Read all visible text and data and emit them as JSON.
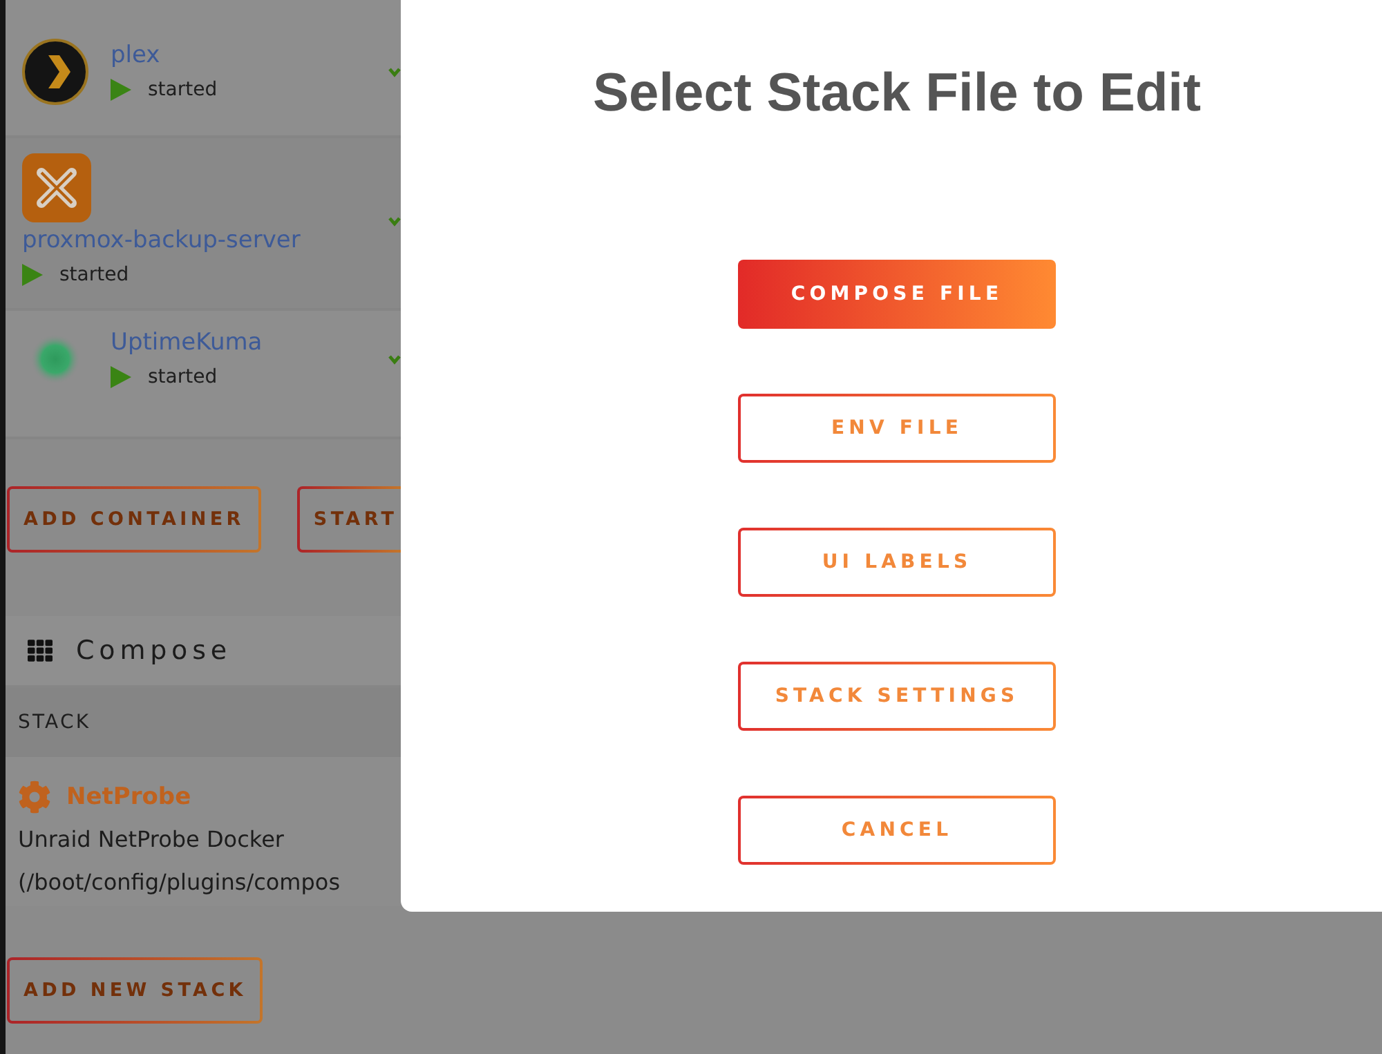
{
  "containers": [
    {
      "name": "plex",
      "status": "started"
    },
    {
      "name": "proxmox-backup-server",
      "status": "started"
    },
    {
      "name": "UptimeKuma",
      "status": "started"
    }
  ],
  "container_actions": [
    "ADD CONTAINER",
    "START"
  ],
  "compose": {
    "title": "Compose",
    "column_header": "STACK",
    "stacks": [
      {
        "name": "NetProbe",
        "description": "Unraid NetProbe Docker",
        "path": "(/boot/config/plugins/compos"
      }
    ],
    "add_button": "ADD NEW STACK"
  },
  "modal": {
    "title": "Select Stack File to Edit",
    "options": [
      {
        "label": "COMPOSE FILE",
        "kind": "primary"
      },
      {
        "label": "ENV FILE",
        "kind": "outline"
      },
      {
        "label": "UI LABELS",
        "kind": "outline"
      },
      {
        "label": "STACK SETTINGS",
        "kind": "outline"
      },
      {
        "label": "CANCEL",
        "kind": "outline"
      }
    ]
  }
}
